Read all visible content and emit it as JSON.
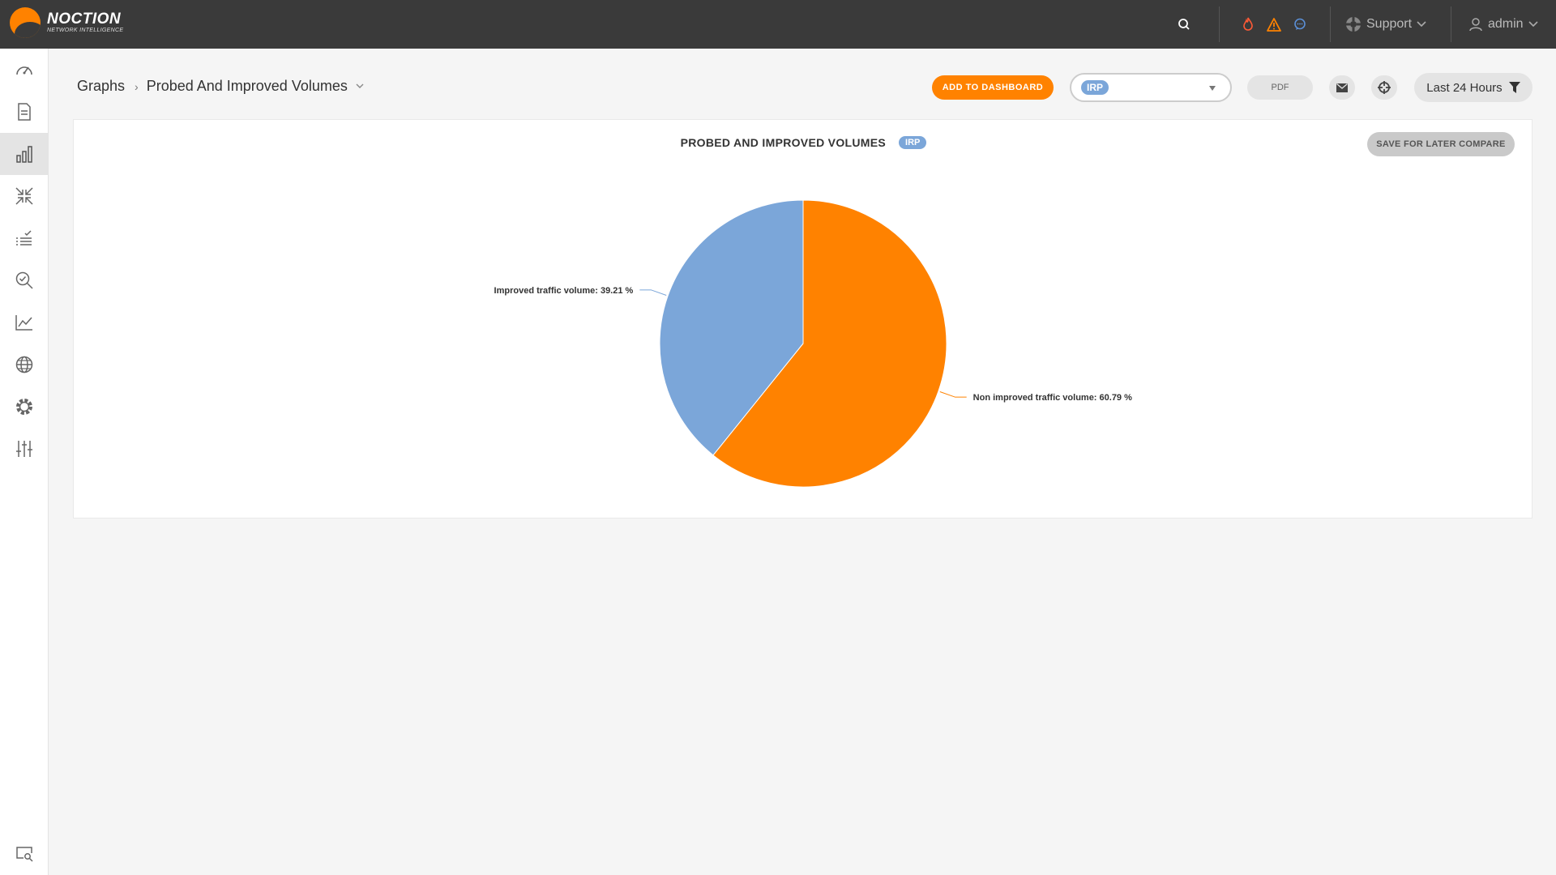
{
  "app": {
    "logo_name": "NOCTION",
    "logo_sub": "NETWORK INTELLIGENCE"
  },
  "topbar": {
    "support_label": "Support",
    "user_label": "admin",
    "icons": [
      "search-icon",
      "flame-icon",
      "warning-icon",
      "chat-icon",
      "support-icon",
      "user-icon"
    ]
  },
  "sidebar": {
    "items": [
      "dashboard-icon",
      "reports-icon",
      "graphs-icon",
      "improvements-icon",
      "events-icon",
      "search-icon",
      "statistics-icon",
      "global-icon",
      "settings-icon",
      "configuration-icon"
    ],
    "bottom_item": "monitor-search-icon",
    "active_index": 2
  },
  "header": {
    "breadcrumb_root": "Graphs",
    "breadcrumb_current": "Probed And Improved Volumes",
    "add_dashboard_label": "ADD TO DASHBOARD",
    "select_value": "IRP",
    "pdf_label": "PDF",
    "time_range_label": "Last 24 Hours"
  },
  "panel": {
    "save_label": "SAVE FOR LATER COMPARE"
  },
  "colors": {
    "accent": "#ff8200",
    "improved": "#7ba6d9",
    "non_improved": "#ff8200"
  },
  "chart_data": {
    "type": "pie",
    "title": "PROBED AND IMPROVED VOLUMES",
    "title_tag": "IRP",
    "slices": [
      {
        "label": "Non improved traffic volume",
        "value": 60.79,
        "text": "Non improved traffic volume: 60.79 %",
        "color": "#ff8200"
      },
      {
        "label": "Improved traffic volume",
        "value": 39.21,
        "text": "Improved traffic volume: 39.21 %",
        "color": "#7ba6d9"
      }
    ]
  }
}
